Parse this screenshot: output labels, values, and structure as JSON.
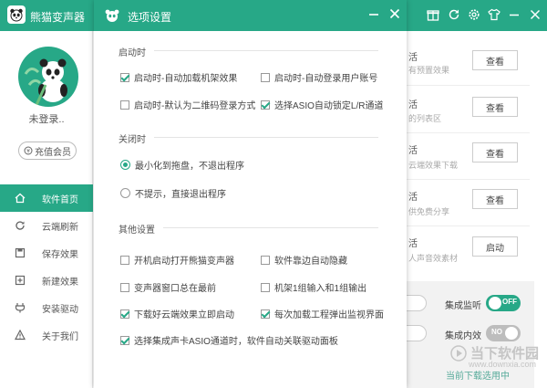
{
  "app": {
    "title": "熊猫变声器",
    "login_status": "未登录..",
    "recharge_label": "充值会员"
  },
  "titlebar_icons": [
    "gift-icon",
    "reload-icon",
    "settings-icon",
    "shirt-icon",
    "minimize-icon",
    "close-icon"
  ],
  "sidebar": {
    "items": [
      {
        "label": "软件首页",
        "icon": "home-icon",
        "active": true
      },
      {
        "label": "云端刷新",
        "icon": "refresh-icon",
        "active": false
      },
      {
        "label": "保存效果",
        "icon": "save-icon",
        "active": false
      },
      {
        "label": "新建效果",
        "icon": "new-icon",
        "active": false
      },
      {
        "label": "安装驱动",
        "icon": "plug-icon",
        "active": false
      },
      {
        "label": "关于我们",
        "icon": "info-icon",
        "active": false
      }
    ]
  },
  "content": {
    "rows": [
      {
        "label": "活",
        "sub": "有预置效果",
        "button": "查看"
      },
      {
        "label": "活",
        "sub": "的列表区",
        "button": "查看"
      },
      {
        "label": "活",
        "sub": "云端效果下载",
        "button": "查看"
      },
      {
        "label": "活",
        "sub": "供免费分享",
        "button": "查看"
      },
      {
        "label": "活",
        "sub": "人声音效素材",
        "button": "启动"
      }
    ],
    "toggles": [
      {
        "label": "集成监听",
        "state": "OFF",
        "on": true
      },
      {
        "label": "集成内效",
        "state": "NO",
        "on": false
      }
    ],
    "bottom_link": "当前下载选用中",
    "watermark": "当下软件园",
    "watermark_url": "www.downxia.com"
  },
  "dialog": {
    "title": "选项设置",
    "sections": {
      "startup": {
        "title": "启动时",
        "options": [
          {
            "label": "启动时-自动加载机架效果",
            "checked": true
          },
          {
            "label": "启动时-自动登录用户账号",
            "checked": false
          },
          {
            "label": "启动时-默认为二维码登录方式",
            "checked": false
          },
          {
            "label": "选择ASIO自动锁定L/R通道",
            "checked": true
          }
        ]
      },
      "close": {
        "title": "关闭时",
        "options": [
          {
            "label": "最小化到拖盘，不退出程序",
            "checked": true
          },
          {
            "label": "不提示，直接退出程序",
            "checked": false
          }
        ]
      },
      "other": {
        "title": "其他设置",
        "options": [
          {
            "label": "开机启动打开熊猫变声器",
            "checked": false
          },
          {
            "label": "软件靠边自动隐藏",
            "checked": false
          },
          {
            "label": "变声器窗口总在最前",
            "checked": false
          },
          {
            "label": "机架1组输入和1组输出",
            "checked": false
          },
          {
            "label": "下载好云端效果立即启动",
            "checked": true
          },
          {
            "label": "每次加载工程弹出监视界面",
            "checked": true
          },
          {
            "label": "选择集成声卡ASIO通道时，软件自动关联驱动面板",
            "checked": true
          }
        ]
      }
    }
  },
  "colors": {
    "accent": "#27a887",
    "toggle_off": "#bdbdbd"
  }
}
